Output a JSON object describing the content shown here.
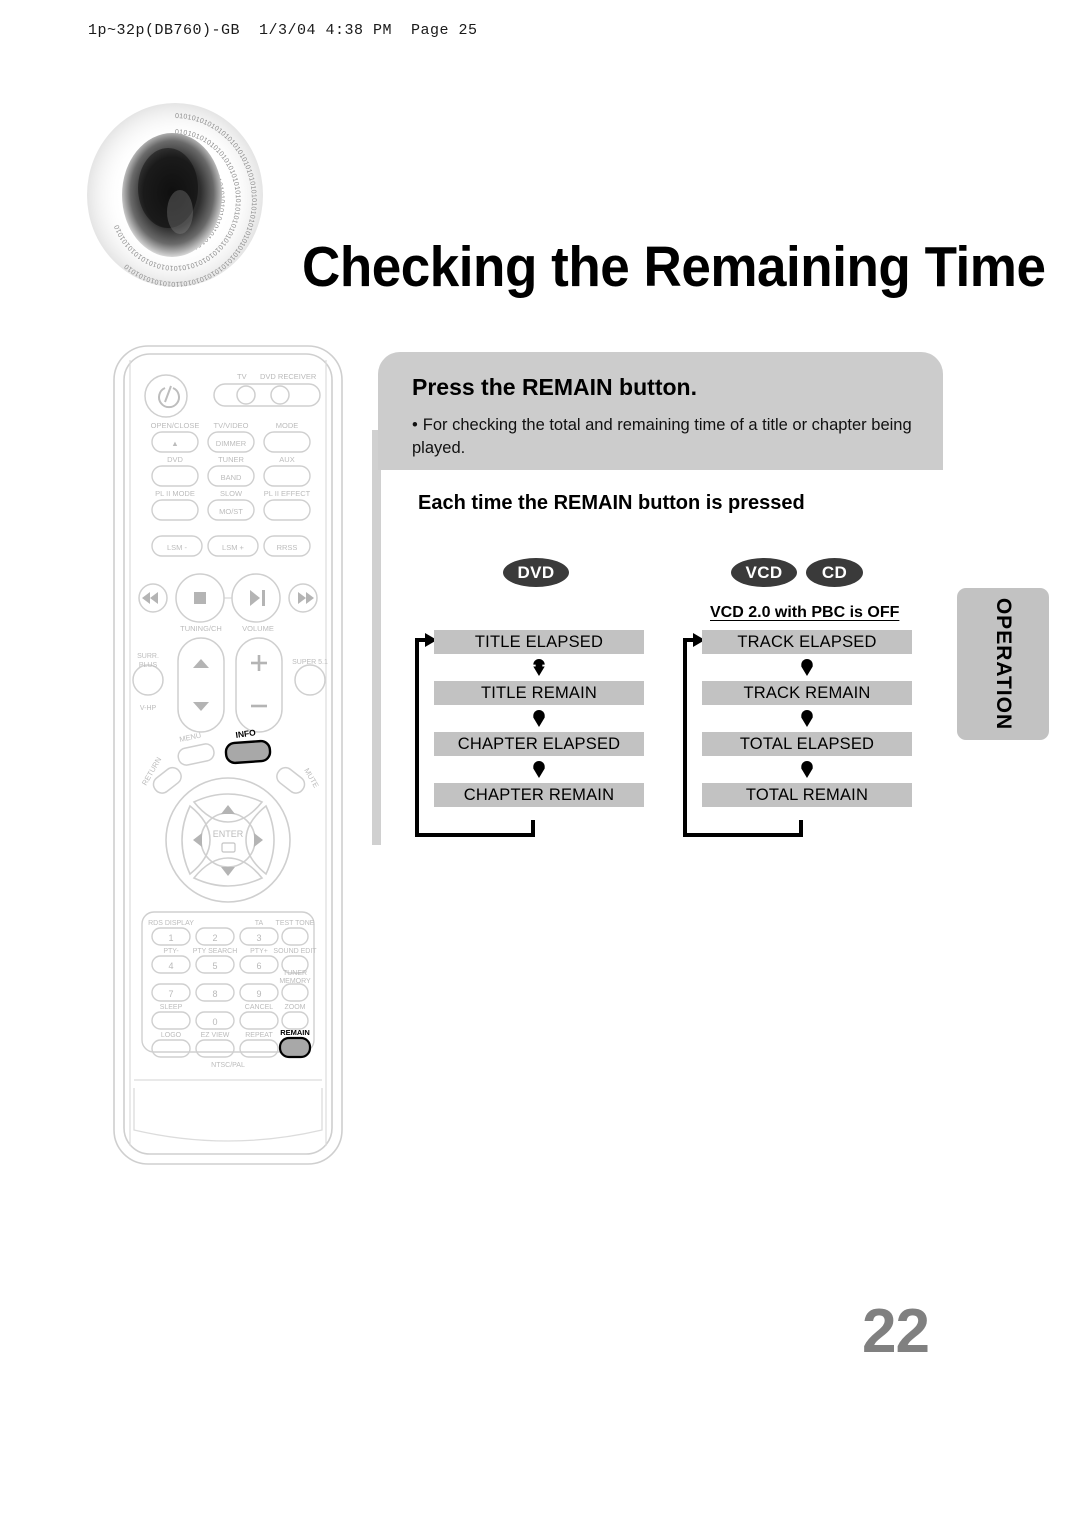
{
  "print_header": "1p~32p(DB760)-GB  1/3/04 4:38 PM  Page 25",
  "title": "Checking the Remaining Time",
  "page_number": "22",
  "instruction": {
    "heading": "Press the REMAIN button.",
    "bullet_dot": "•",
    "bullet_text": "For checking the total and remaining time of a title or chapter being played."
  },
  "subheading": "Each time the REMAIN button is pressed",
  "badges": {
    "dvd": "DVD",
    "vcd": "VCD",
    "cd": "CD",
    "pbc_note": "VCD 2.0 with PBC is OFF"
  },
  "side_tab": "OPERATION",
  "flows": {
    "dvd": [
      "TITLE ELAPSED",
      "TITLE REMAIN",
      "CHAPTER ELAPSED",
      "CHAPTER REMAIN"
    ],
    "vcd": [
      "TRACK ELAPSED",
      "TRACK REMAIN",
      "TOTAL ELAPSED",
      "TOTAL REMAIN"
    ]
  },
  "colors": {
    "box_gray": "#c2c2c2",
    "panel_gray": "#cccccc",
    "badge_dark": "#3a3a3a",
    "page_number_gray": "#808080",
    "highlight_button": "#a8a8a8"
  },
  "remote": {
    "device_select": {
      "tv": "TV",
      "receiver": "DVD RECEIVER"
    },
    "row_open": [
      "OPEN/CLOSE",
      "TV/VIDEO",
      "MODE"
    ],
    "row_open_sub": [
      "",
      "DIMMER",
      ""
    ],
    "row_source": [
      "DVD",
      "TUNER",
      "AUX"
    ],
    "row_source_sub": [
      "",
      "BAND",
      ""
    ],
    "row_pl": [
      "PL II MODE",
      "SLOW",
      "PL II EFFECT"
    ],
    "row_pl_sub": [
      "",
      "MO/ST",
      ""
    ],
    "row_lsm": [
      "LSM -",
      "LSM +",
      "RRSS"
    ],
    "transport_labels": {
      "tuning": "TUNING/CH",
      "volume": "VOLUME"
    },
    "side_left": {
      "top": "SURR.",
      "mid": "PLUS",
      "bottom": "V-HP"
    },
    "side_right": "SUPER 5.1",
    "nav": {
      "menu": "MENU",
      "info": "INFO",
      "return": "RETURN",
      "mute": "MUTE",
      "enter": "ENTER"
    },
    "keypad_labels_row1": [
      "RDS DISPLAY",
      "TA",
      "TEST TONE"
    ],
    "keypad_row1": [
      "1",
      "2",
      "3"
    ],
    "keypad_labels_row2": [
      "PTY-",
      "PTY SEARCH",
      "PTY+",
      "SOUND EDIT"
    ],
    "keypad_row2": [
      "4",
      "5",
      "6"
    ],
    "keypad_labels_row3": [
      "TUNER",
      "MEMORY"
    ],
    "keypad_row3": [
      "7",
      "8",
      "9"
    ],
    "keypad_labels_row4": [
      "SLEEP",
      "CANCEL",
      "ZOOM"
    ],
    "keypad_row4": [
      "0"
    ],
    "keypad_labels_row5": [
      "LOGO",
      "EZ VIEW",
      "REPEAT",
      "REMAIN"
    ],
    "keypad_bottom": "NTSC/PAL"
  }
}
